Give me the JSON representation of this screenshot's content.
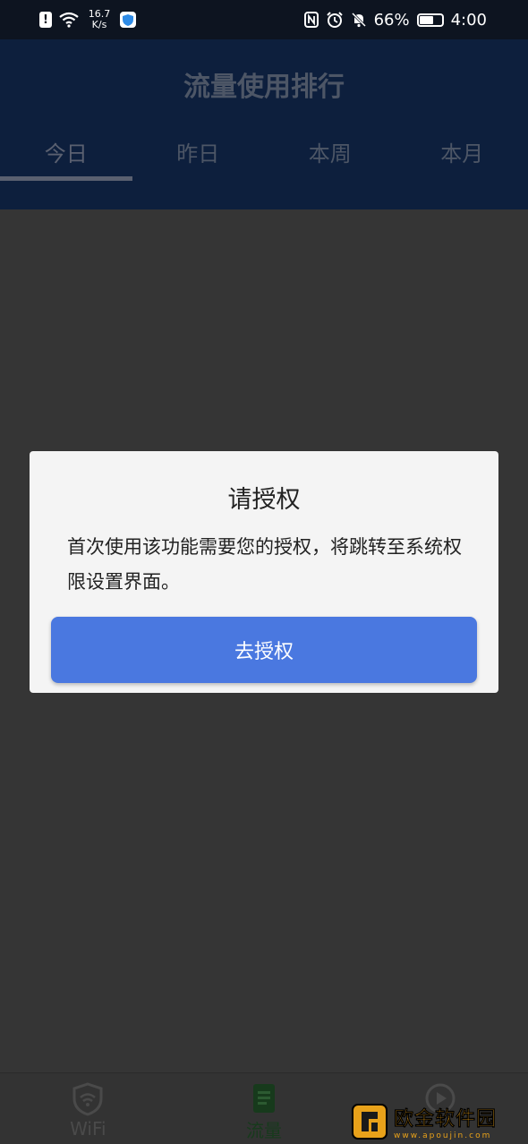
{
  "status_bar": {
    "net_speed_value": "16.7",
    "net_speed_unit": "K/s",
    "battery_percent": "66%",
    "battery_level": 0.66,
    "time": "4:00"
  },
  "header": {
    "title": "流量使用排行",
    "tabs": [
      {
        "label": "今日",
        "active": true
      },
      {
        "label": "昨日",
        "active": false
      },
      {
        "label": "本周",
        "active": false
      },
      {
        "label": "本月",
        "active": false
      }
    ]
  },
  "dialog": {
    "title": "请授权",
    "message": "首次使用该功能需要您的授权，将跳转至系统权限设置界面。",
    "button_label": "去授权"
  },
  "bottom_nav": {
    "items": [
      {
        "label": "WiFi",
        "icon": "wifi-shield-icon",
        "active": false
      },
      {
        "label": "流量",
        "icon": "document-icon",
        "active": true
      },
      {
        "label": "",
        "icon": "play-icon",
        "active": false
      }
    ]
  },
  "watermark": {
    "text_cn": "欧金软件园",
    "text_en": "www.apoujin.com",
    "color": "#e9a21a"
  },
  "colors": {
    "header_bg": "#0d1f3d",
    "overlay_bg": "#353535",
    "dialog_bg": "#f4f4f4",
    "button_bg": "#4a78e0",
    "active_nav": "#173a1c"
  }
}
